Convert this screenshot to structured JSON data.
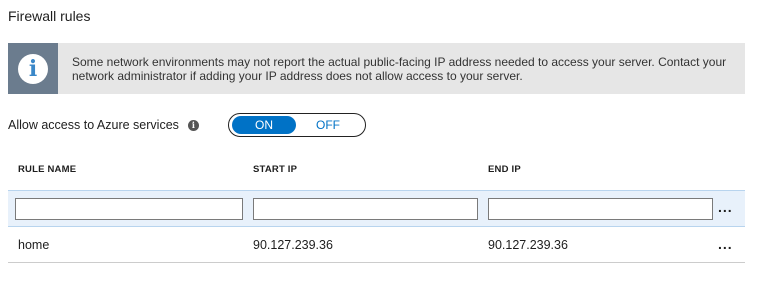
{
  "section": {
    "title": "Firewall rules"
  },
  "info_banner": {
    "icon": "info-icon",
    "glyph": "i",
    "text": "Some network environments may not report the actual public-facing IP address needed to access your server.  Contact your network administrator if adding your IP address does not allow access to your server."
  },
  "azure_access": {
    "label": "Allow access to Azure services",
    "help_glyph": "i",
    "on_label": "ON",
    "off_label": "OFF",
    "selected": "ON"
  },
  "table": {
    "headers": [
      "RULE NAME",
      "START IP",
      "END IP"
    ],
    "new_row": {
      "rule_name": "",
      "start_ip": "",
      "end_ip": "",
      "more_label": "..."
    },
    "rows": [
      {
        "rule_name": "home",
        "start_ip": "90.127.239.36",
        "end_ip": "90.127.239.36",
        "more_label": "..."
      }
    ]
  },
  "colors": {
    "accent": "#0072c6",
    "banner_bg": "#e6e6e6",
    "banner_icon_bg": "#6b7c8e",
    "new_row_bg": "#e8f1fb"
  }
}
